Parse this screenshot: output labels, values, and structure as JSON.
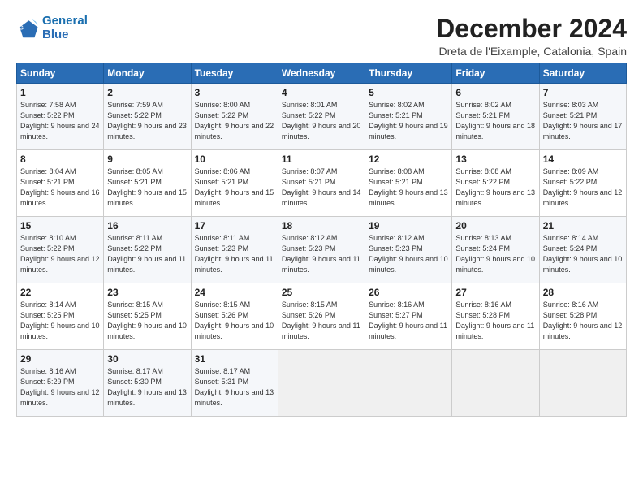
{
  "logo": {
    "line1": "General",
    "line2": "Blue"
  },
  "title": "December 2024",
  "subtitle": "Dreta de l'Eixample, Catalonia, Spain",
  "headers": [
    "Sunday",
    "Monday",
    "Tuesday",
    "Wednesday",
    "Thursday",
    "Friday",
    "Saturday"
  ],
  "weeks": [
    [
      {
        "num": "1",
        "sunrise": "Sunrise: 7:58 AM",
        "sunset": "Sunset: 5:22 PM",
        "daylight": "Daylight: 9 hours and 24 minutes."
      },
      {
        "num": "2",
        "sunrise": "Sunrise: 7:59 AM",
        "sunset": "Sunset: 5:22 PM",
        "daylight": "Daylight: 9 hours and 23 minutes."
      },
      {
        "num": "3",
        "sunrise": "Sunrise: 8:00 AM",
        "sunset": "Sunset: 5:22 PM",
        "daylight": "Daylight: 9 hours and 22 minutes."
      },
      {
        "num": "4",
        "sunrise": "Sunrise: 8:01 AM",
        "sunset": "Sunset: 5:22 PM",
        "daylight": "Daylight: 9 hours and 20 minutes."
      },
      {
        "num": "5",
        "sunrise": "Sunrise: 8:02 AM",
        "sunset": "Sunset: 5:21 PM",
        "daylight": "Daylight: 9 hours and 19 minutes."
      },
      {
        "num": "6",
        "sunrise": "Sunrise: 8:02 AM",
        "sunset": "Sunset: 5:21 PM",
        "daylight": "Daylight: 9 hours and 18 minutes."
      },
      {
        "num": "7",
        "sunrise": "Sunrise: 8:03 AM",
        "sunset": "Sunset: 5:21 PM",
        "daylight": "Daylight: 9 hours and 17 minutes."
      }
    ],
    [
      {
        "num": "8",
        "sunrise": "Sunrise: 8:04 AM",
        "sunset": "Sunset: 5:21 PM",
        "daylight": "Daylight: 9 hours and 16 minutes."
      },
      {
        "num": "9",
        "sunrise": "Sunrise: 8:05 AM",
        "sunset": "Sunset: 5:21 PM",
        "daylight": "Daylight: 9 hours and 15 minutes."
      },
      {
        "num": "10",
        "sunrise": "Sunrise: 8:06 AM",
        "sunset": "Sunset: 5:21 PM",
        "daylight": "Daylight: 9 hours and 15 minutes."
      },
      {
        "num": "11",
        "sunrise": "Sunrise: 8:07 AM",
        "sunset": "Sunset: 5:21 PM",
        "daylight": "Daylight: 9 hours and 14 minutes."
      },
      {
        "num": "12",
        "sunrise": "Sunrise: 8:08 AM",
        "sunset": "Sunset: 5:21 PM",
        "daylight": "Daylight: 9 hours and 13 minutes."
      },
      {
        "num": "13",
        "sunrise": "Sunrise: 8:08 AM",
        "sunset": "Sunset: 5:22 PM",
        "daylight": "Daylight: 9 hours and 13 minutes."
      },
      {
        "num": "14",
        "sunrise": "Sunrise: 8:09 AM",
        "sunset": "Sunset: 5:22 PM",
        "daylight": "Daylight: 9 hours and 12 minutes."
      }
    ],
    [
      {
        "num": "15",
        "sunrise": "Sunrise: 8:10 AM",
        "sunset": "Sunset: 5:22 PM",
        "daylight": "Daylight: 9 hours and 12 minutes."
      },
      {
        "num": "16",
        "sunrise": "Sunrise: 8:11 AM",
        "sunset": "Sunset: 5:22 PM",
        "daylight": "Daylight: 9 hours and 11 minutes."
      },
      {
        "num": "17",
        "sunrise": "Sunrise: 8:11 AM",
        "sunset": "Sunset: 5:23 PM",
        "daylight": "Daylight: 9 hours and 11 minutes."
      },
      {
        "num": "18",
        "sunrise": "Sunrise: 8:12 AM",
        "sunset": "Sunset: 5:23 PM",
        "daylight": "Daylight: 9 hours and 11 minutes."
      },
      {
        "num": "19",
        "sunrise": "Sunrise: 8:12 AM",
        "sunset": "Sunset: 5:23 PM",
        "daylight": "Daylight: 9 hours and 10 minutes."
      },
      {
        "num": "20",
        "sunrise": "Sunrise: 8:13 AM",
        "sunset": "Sunset: 5:24 PM",
        "daylight": "Daylight: 9 hours and 10 minutes."
      },
      {
        "num": "21",
        "sunrise": "Sunrise: 8:14 AM",
        "sunset": "Sunset: 5:24 PM",
        "daylight": "Daylight: 9 hours and 10 minutes."
      }
    ],
    [
      {
        "num": "22",
        "sunrise": "Sunrise: 8:14 AM",
        "sunset": "Sunset: 5:25 PM",
        "daylight": "Daylight: 9 hours and 10 minutes."
      },
      {
        "num": "23",
        "sunrise": "Sunrise: 8:15 AM",
        "sunset": "Sunset: 5:25 PM",
        "daylight": "Daylight: 9 hours and 10 minutes."
      },
      {
        "num": "24",
        "sunrise": "Sunrise: 8:15 AM",
        "sunset": "Sunset: 5:26 PM",
        "daylight": "Daylight: 9 hours and 10 minutes."
      },
      {
        "num": "25",
        "sunrise": "Sunrise: 8:15 AM",
        "sunset": "Sunset: 5:26 PM",
        "daylight": "Daylight: 9 hours and 11 minutes."
      },
      {
        "num": "26",
        "sunrise": "Sunrise: 8:16 AM",
        "sunset": "Sunset: 5:27 PM",
        "daylight": "Daylight: 9 hours and 11 minutes."
      },
      {
        "num": "27",
        "sunrise": "Sunrise: 8:16 AM",
        "sunset": "Sunset: 5:28 PM",
        "daylight": "Daylight: 9 hours and 11 minutes."
      },
      {
        "num": "28",
        "sunrise": "Sunrise: 8:16 AM",
        "sunset": "Sunset: 5:28 PM",
        "daylight": "Daylight: 9 hours and 12 minutes."
      }
    ],
    [
      {
        "num": "29",
        "sunrise": "Sunrise: 8:16 AM",
        "sunset": "Sunset: 5:29 PM",
        "daylight": "Daylight: 9 hours and 12 minutes."
      },
      {
        "num": "30",
        "sunrise": "Sunrise: 8:17 AM",
        "sunset": "Sunset: 5:30 PM",
        "daylight": "Daylight: 9 hours and 13 minutes."
      },
      {
        "num": "31",
        "sunrise": "Sunrise: 8:17 AM",
        "sunset": "Sunset: 5:31 PM",
        "daylight": "Daylight: 9 hours and 13 minutes."
      },
      null,
      null,
      null,
      null
    ]
  ]
}
